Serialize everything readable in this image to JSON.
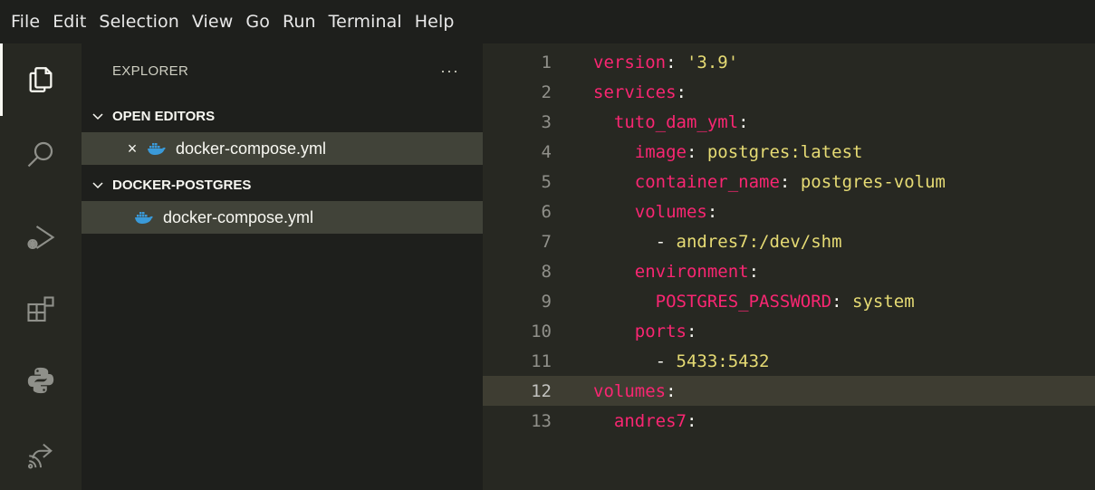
{
  "menu": [
    "File",
    "Edit",
    "Selection",
    "View",
    "Go",
    "Run",
    "Terminal",
    "Help"
  ],
  "activity_bar": {
    "icons": [
      "explorer-icon",
      "search-icon",
      "run-debug-icon",
      "extensions-icon",
      "python-icon",
      "remote-icon"
    ],
    "active": "explorer-icon"
  },
  "sidebar": {
    "title": "EXPLORER",
    "more": "···",
    "open_editors": {
      "label": "OPEN EDITORS",
      "files": [
        {
          "name": "docker-compose.yml",
          "close": "×"
        }
      ]
    },
    "folder": {
      "label": "DOCKER-POSTGRES",
      "files": [
        {
          "name": "docker-compose.yml"
        }
      ]
    }
  },
  "editor": {
    "current_line": 12,
    "lines": [
      {
        "n": "1",
        "indent": "",
        "key": "version",
        "sep": ": ",
        "val": "'3.9'",
        "val_type": "s"
      },
      {
        "n": "2",
        "indent": "",
        "key": "services",
        "sep": ":",
        "val": "",
        "val_type": "v"
      },
      {
        "n": "3",
        "indent": "  ",
        "key": "tuto_dam_yml",
        "sep": ":",
        "val": "",
        "val_type": "v"
      },
      {
        "n": "4",
        "indent": "    ",
        "key": "image",
        "sep": ": ",
        "val": "postgres:latest",
        "val_type": "v"
      },
      {
        "n": "5",
        "indent": "    ",
        "key": "container_name",
        "sep": ": ",
        "val": "postgres-volum",
        "val_type": "v"
      },
      {
        "n": "6",
        "indent": "    ",
        "key": "volumes",
        "sep": ":",
        "val": "",
        "val_type": "v"
      },
      {
        "n": "7",
        "indent": "      ",
        "key": "",
        "sep": "- ",
        "val": "andres7:/dev/shm",
        "val_type": "v"
      },
      {
        "n": "8",
        "indent": "    ",
        "key": "environment",
        "sep": ":",
        "val": "",
        "val_type": "v"
      },
      {
        "n": "9",
        "indent": "      ",
        "key": "POSTGRES_PASSWORD",
        "sep": ": ",
        "val": "system",
        "val_type": "v"
      },
      {
        "n": "10",
        "indent": "    ",
        "key": "ports",
        "sep": ":",
        "val": "",
        "val_type": "v"
      },
      {
        "n": "11",
        "indent": "      ",
        "key": "",
        "sep": "- ",
        "val": "5433:5432",
        "val_type": "v"
      },
      {
        "n": "12",
        "indent": "",
        "key": "volumes",
        "sep": ":",
        "val": "",
        "val_type": "v"
      },
      {
        "n": "13",
        "indent": "  ",
        "key": "andres7",
        "sep": ":",
        "val": "",
        "val_type": "v"
      }
    ]
  },
  "colors": {
    "keyword": "#f92672",
    "string": "#e6db74",
    "line_number": "#90908a",
    "editor_bg": "#272822",
    "sidebar_bg": "#1e1f1c",
    "selection_bg": "#414339",
    "current_line_bg": "#3e3d32"
  }
}
